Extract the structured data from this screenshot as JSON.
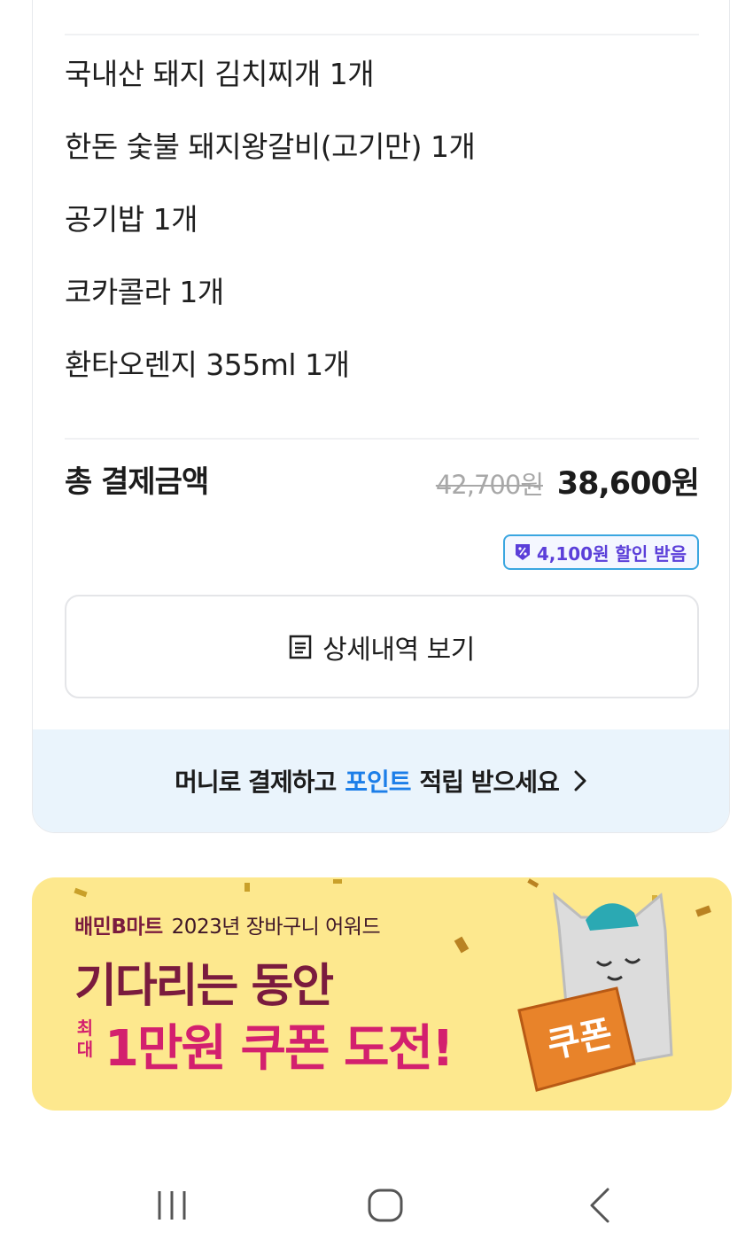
{
  "order": {
    "items": [
      "국내산 돼지 김치찌개 1개",
      "한돈 숯불 돼지왕갈비(고기만) 1개",
      "공기밥 1개",
      "코카콜라 1개",
      "환타오렌지 355ml 1개"
    ],
    "total_label": "총 결제금액",
    "original_price": "42,700원",
    "final_price": "38,600원",
    "discount_badge": "4,100원 할인 받음",
    "detail_button": "상세내역 보기"
  },
  "promo": {
    "prefix": "머니로 결제하고",
    "highlight": "포인트",
    "suffix": "적립 받으세요"
  },
  "banner": {
    "brand": "배민B마트",
    "subtitle": "2023년 장바구니 어워드",
    "headline": "기다리는 동안",
    "max_label": "최대",
    "coupon_text": "1만원 쿠폰 도전!",
    "coupon_tag": "쿠폰"
  },
  "icons": {
    "discount": "discount-badge-icon",
    "detail": "receipt-icon",
    "chevron": "chevron-right-icon",
    "recents": "recents-icon",
    "home": "home-icon",
    "back": "back-icon"
  },
  "colors": {
    "highlight": "#1c7ee8",
    "banner_bg": "#fde88e",
    "banner_text": "#7a1b3e",
    "badge_text": "#5b3fd9"
  }
}
